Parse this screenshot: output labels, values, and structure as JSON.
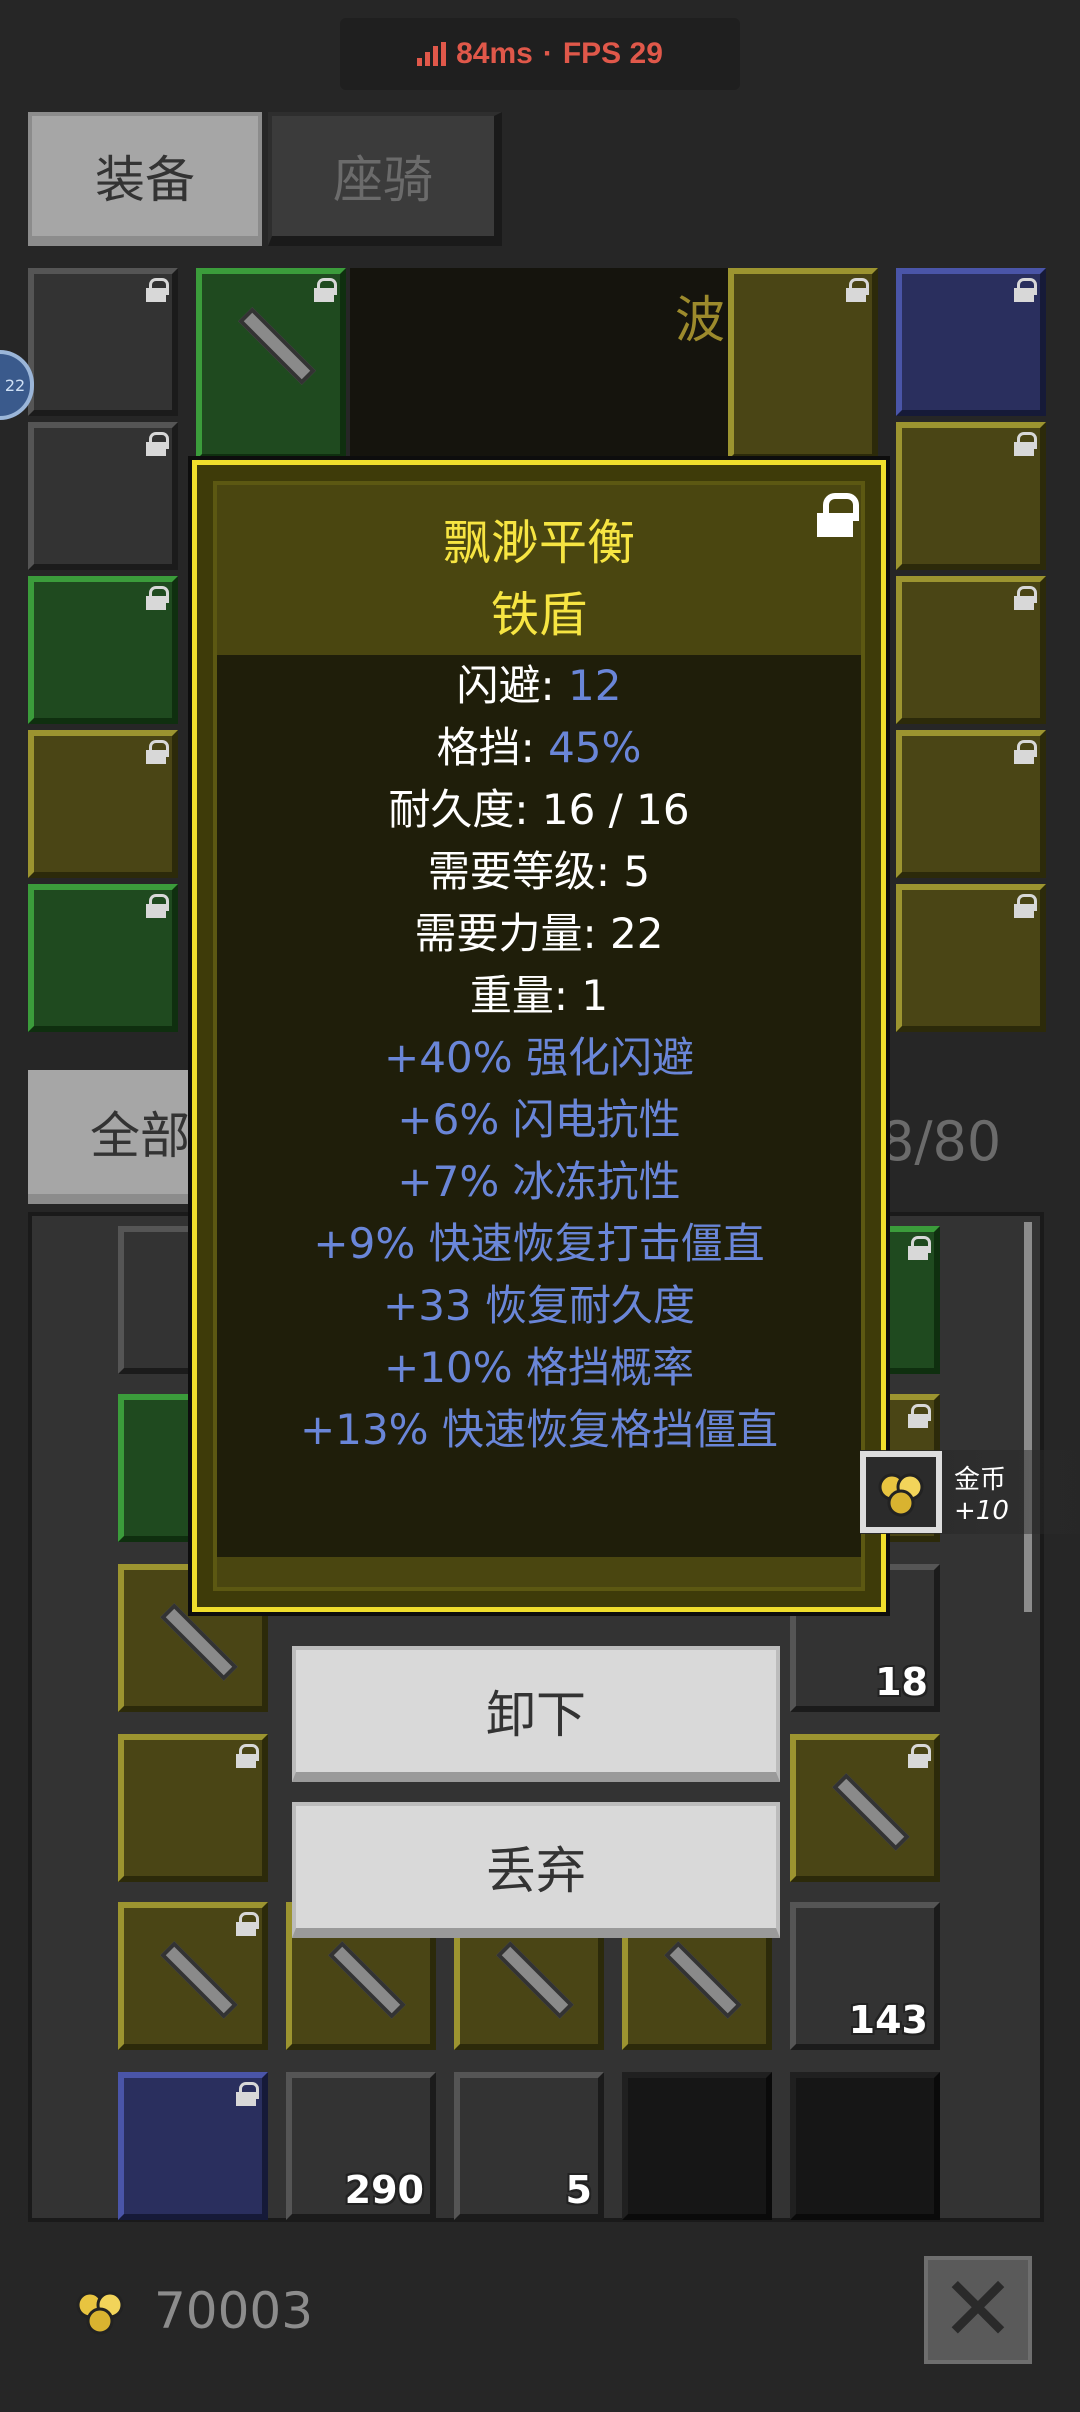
{
  "status": {
    "ping": "84ms",
    "separator": "·",
    "fps": "FPS 29"
  },
  "tabs": [
    {
      "label": "装备",
      "active": true
    },
    {
      "label": "座骑",
      "active": false
    }
  ],
  "header": {
    "preview_label": "波罗",
    "avatar_level": "22"
  },
  "inventory": {
    "filter_label": "全部",
    "capacity": "8/80",
    "counts": {
      "scroll": "18",
      "feather": "143",
      "ore": "290",
      "gold_ore": "5"
    }
  },
  "tooltip": {
    "name_line1": "飘渺平衡",
    "name_line2": "铁盾",
    "stats": [
      {
        "label": "闪避: ",
        "value": "12"
      },
      {
        "label": "格挡: ",
        "value": "45%"
      },
      {
        "label": "耐久度: 16 / 16",
        "value": ""
      },
      {
        "label": "需要等级: 5",
        "value": ""
      },
      {
        "label": "需要力量: 22",
        "value": ""
      },
      {
        "label": "重量: 1",
        "value": ""
      }
    ],
    "modifiers": [
      "+40% 强化闪避",
      "+6% 闪电抗性",
      "+7% 冰冻抗性",
      "+9% 快速恢复打击僵直",
      "+33 恢复耐久度",
      "+10% 格挡概率",
      "+13% 快速恢复格挡僵直"
    ]
  },
  "actions": {
    "unequip": "卸下",
    "drop": "丢弃"
  },
  "toast": {
    "title": "金币",
    "amount": "+10"
  },
  "footer": {
    "gold": "70003"
  },
  "colors": {
    "tooltip_border": "#f0de2c",
    "modifier_blue": "#6a86d8",
    "status_red": "#e0584a"
  }
}
